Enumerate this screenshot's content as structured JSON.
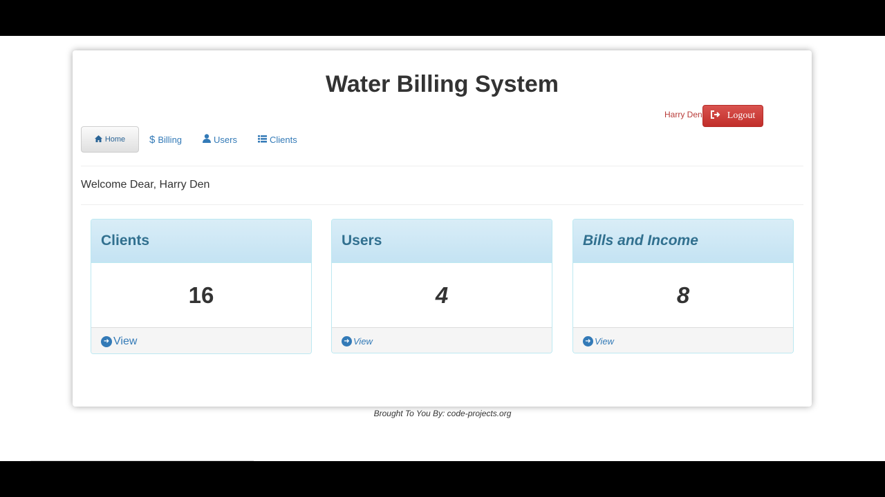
{
  "header": {
    "title": "Water Billing System"
  },
  "user": {
    "name": "Harry Den",
    "logout_label": "Logout"
  },
  "nav": {
    "home": "Home",
    "billing": "Billing",
    "users": "Users",
    "clients": "Clients"
  },
  "welcome": "Welcome Dear, Harry Den",
  "panels": [
    {
      "title": "Clients",
      "count": "16",
      "view": "View"
    },
    {
      "title": "Users",
      "count": "4",
      "view": "View"
    },
    {
      "title": "Bills and Income",
      "count": "8",
      "view": "View"
    }
  ],
  "footer": "Brought To You By: code-projects.org",
  "colors": {
    "primary": "#337ab7",
    "danger": "#d9534f",
    "info_bg": "#d9edf7",
    "info_text": "#31708f"
  },
  "icons": [
    "home-icon",
    "dollar-icon",
    "user-icon",
    "list-icon",
    "logout-icon",
    "circle-arrow-right-icon"
  ]
}
